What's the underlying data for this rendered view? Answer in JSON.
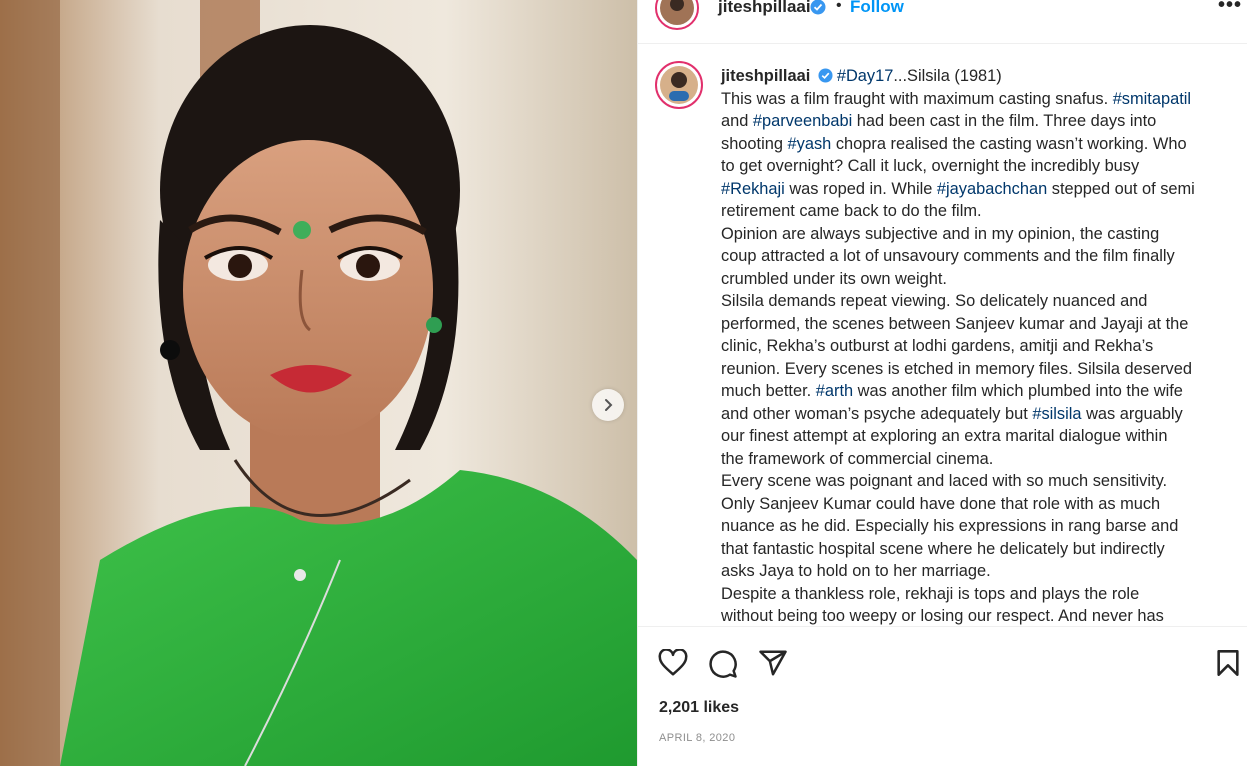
{
  "post": {
    "username": "jiteshpillaai",
    "follow_label": "Follow",
    "separator": "•",
    "more_label": "•••",
    "verified_icon": "verified-badge-icon",
    "caption_lines": [
      {
        "segments": [
          {
            "t": "#Day17",
            "tag": true
          },
          {
            "t": "...Silsila (1981)"
          }
        ]
      },
      {
        "segments": [
          {
            "t": "This was a film fraught with maximum casting snafus. "
          },
          {
            "t": "#smitapatil",
            "tag": true
          }
        ]
      },
      {
        "segments": [
          {
            "t": "and "
          },
          {
            "t": "#parveenbabi",
            "tag": true
          },
          {
            "t": " had been cast in the film. Three days into"
          }
        ]
      },
      {
        "segments": [
          {
            "t": "shooting "
          },
          {
            "t": "#yash",
            "tag": true
          },
          {
            "t": " chopra realised the casting wasn’t working. Who"
          }
        ]
      },
      {
        "segments": [
          {
            "t": "to get overnight? Call it luck, overnight the incredibly busy"
          }
        ]
      },
      {
        "segments": [
          {
            "t": "#Rekhaji",
            "tag": true
          },
          {
            "t": " was roped in. While "
          },
          {
            "t": "#jayabachchan",
            "tag": true
          },
          {
            "t": " stepped out of semi"
          }
        ]
      },
      {
        "segments": [
          {
            "t": "retirement came back to do the film."
          }
        ]
      },
      {
        "segments": [
          {
            "t": "Opinion are always subjective and in my opinion, the casting"
          }
        ]
      },
      {
        "segments": [
          {
            "t": "coup attracted a lot of unsavoury comments and the film finally"
          }
        ]
      },
      {
        "segments": [
          {
            "t": "crumbled under its own weight."
          }
        ]
      },
      {
        "segments": [
          {
            "t": "Silsila demands repeat viewing. So delicately nuanced and"
          }
        ]
      },
      {
        "segments": [
          {
            "t": "performed, the scenes between Sanjeev kumar and Jayaji at the"
          }
        ]
      },
      {
        "segments": [
          {
            "t": "clinic, Rekha’s outburst at lodhi gardens, amitji and Rekha’s"
          }
        ]
      },
      {
        "segments": [
          {
            "t": "reunion. Every scenes is etched in memory files. Silsila deserved"
          }
        ]
      },
      {
        "segments": [
          {
            "t": "much better. "
          },
          {
            "t": "#arth",
            "tag": true
          },
          {
            "t": " was another film which plumbed into the wife"
          }
        ]
      },
      {
        "segments": [
          {
            "t": "and other woman’s psyche adequately but "
          },
          {
            "t": "#silsila",
            "tag": true
          },
          {
            "t": " was arguably"
          }
        ]
      },
      {
        "segments": [
          {
            "t": "our finest attempt at exploring an extra marital dialogue within"
          }
        ]
      },
      {
        "segments": [
          {
            "t": "the framework of commercial cinema."
          }
        ]
      },
      {
        "segments": [
          {
            "t": "Every scene was poignant and laced with so much sensitivity."
          }
        ]
      },
      {
        "segments": [
          {
            "t": "Only Sanjeev Kumar could have done that role with as much"
          }
        ]
      },
      {
        "segments": [
          {
            "t": "nuance as he did. Especially his expressions in rang barse and"
          }
        ]
      },
      {
        "segments": [
          {
            "t": "that fantastic hospital scene where he delicately but indirectly"
          }
        ]
      },
      {
        "segments": [
          {
            "t": "asks Jaya to hold on to her marriage."
          }
        ]
      },
      {
        "segments": [
          {
            "t": "Despite a thankless role, rekhaji is tops and plays the role"
          }
        ]
      },
      {
        "segments": [
          {
            "t": "without being too weepy or losing our respect. And never has"
          }
        ]
      }
    ],
    "likes": "2,201 likes",
    "date": "APRIL 8, 2020"
  },
  "icons": {
    "like": "heart-icon",
    "comment": "comment-icon",
    "share": "share-icon",
    "save": "bookmark-icon",
    "next": "chevron-right-icon"
  },
  "colors": {
    "link": "#00376b",
    "follow": "#0095f6",
    "verified": "#3897f0",
    "saree": "#2fae3c"
  }
}
